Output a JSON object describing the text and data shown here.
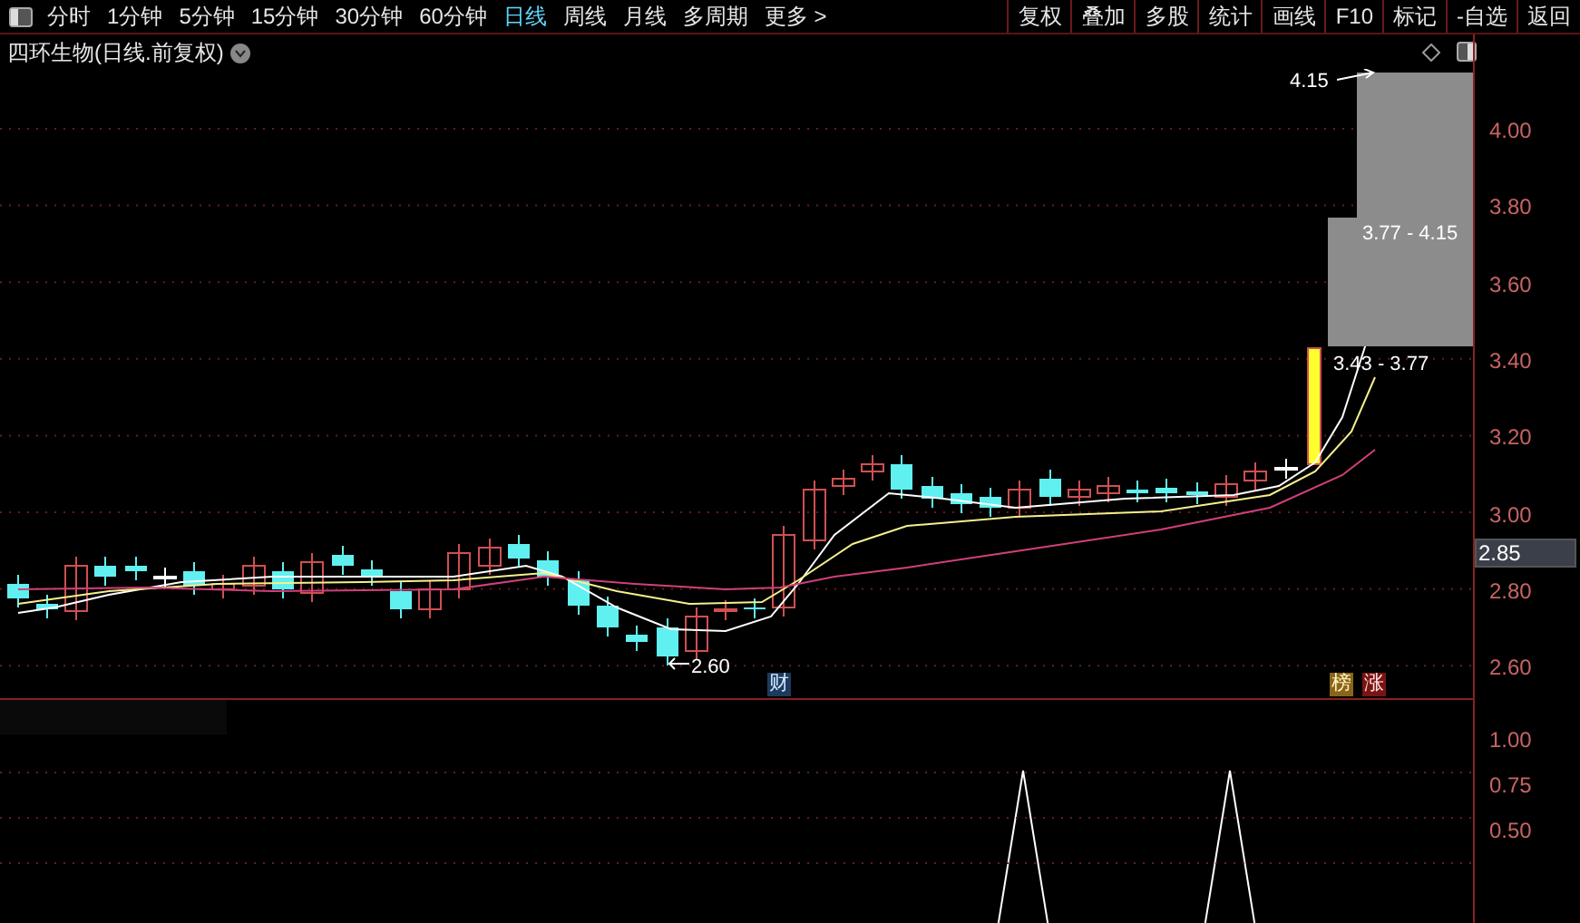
{
  "toolbar": {
    "periods": [
      {
        "label": "分时",
        "selected": false
      },
      {
        "label": "1分钟",
        "selected": false
      },
      {
        "label": "5分钟",
        "selected": false
      },
      {
        "label": "15分钟",
        "selected": false
      },
      {
        "label": "30分钟",
        "selected": false
      },
      {
        "label": "60分钟",
        "selected": false
      },
      {
        "label": "日线",
        "selected": true
      },
      {
        "label": "周线",
        "selected": false
      },
      {
        "label": "月线",
        "selected": false
      },
      {
        "label": "多周期",
        "selected": false
      },
      {
        "label": "更多 >",
        "selected": false
      }
    ],
    "actions": [
      "复权",
      "叠加",
      "多股",
      "统计",
      "画线",
      "F10",
      "标记",
      "-自选",
      "返回"
    ]
  },
  "chart": {
    "title": "四环生物(日线.前复权)",
    "price_ticks": [
      "4.00",
      "3.80",
      "3.60",
      "3.40",
      "3.20",
      "3.00",
      "2.80",
      "2.60"
    ],
    "current_price": "2.85",
    "high_marker": "4.15",
    "low_marker": "2.60",
    "zones": [
      {
        "range": "3.77 - 4.15"
      },
      {
        "range": "3.43 - 3.77"
      }
    ],
    "badges": [
      {
        "label": "财",
        "kind": "finance"
      },
      {
        "label": "榜",
        "kind": "list"
      },
      {
        "label": "涨",
        "kind": "rise"
      }
    ]
  },
  "indicator": {
    "ticks": [
      "1.00",
      "0.75",
      "0.50"
    ]
  }
}
